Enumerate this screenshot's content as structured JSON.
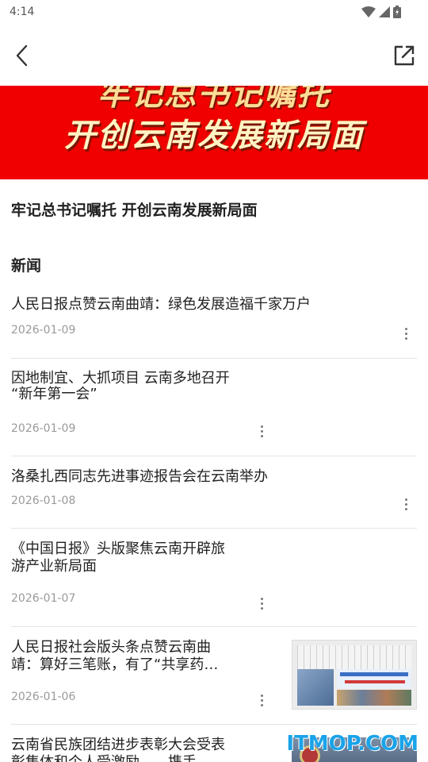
{
  "status_bar": {
    "time": "4:14"
  },
  "app_bar": {
    "back_icon": "chevron-left-icon",
    "share_icon": "open-external-icon"
  },
  "banner": {
    "line1": "牢记总书记嘱托",
    "line2": "开创云南发展新局面",
    "background": "#f00000",
    "text_color": "#fff3c4"
  },
  "article": {
    "title": "牢记总书记嘱托 开创云南发展新局面"
  },
  "section": {
    "title": "新闻"
  },
  "news": [
    {
      "title_line1": "人民日报点赞云南曲靖：绿色发展造福千家万户",
      "title_line2": "",
      "date": "2026-01-09"
    },
    {
      "title_line1": "因地制宜、大抓项目 云南多地召开",
      "title_line2": "“新年第一会”",
      "date": "2026-01-09"
    },
    {
      "title_line1": "洛桑扎西同志先进事迹报告会在云南举办",
      "title_line2": "",
      "date": "2026-01-08"
    },
    {
      "title_line1": "《中国日报》头版聚焦云南开辟旅",
      "title_line2": "游产业新局面",
      "date": "2026-01-07"
    },
    {
      "title_line1": "人民日报社会版头条点赞云南曲",
      "title_line2": "靖：算好三笔账，有了“共享药…",
      "date": "2026-01-06"
    },
    {
      "title_line1": "云南省民族团结进步表彰大会受表",
      "title_line2": "彰集体和个人受激励——携手…",
      "date": ""
    }
  ],
  "watermark": "ITMOP.COM"
}
